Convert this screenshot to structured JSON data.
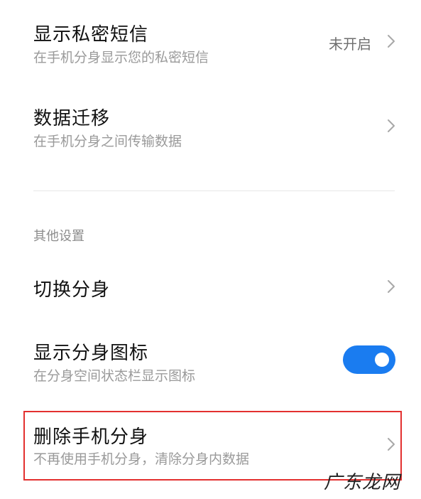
{
  "settings": {
    "private_sms": {
      "title": "显示私密短信",
      "subtitle": "在手机分身显示您的私密短信",
      "value": "未开启"
    },
    "data_migration": {
      "title": "数据迁移",
      "subtitle": "在手机分身之间传输数据"
    },
    "section_other": {
      "label": "其他设置"
    },
    "switch_profile": {
      "title": "切换分身"
    },
    "show_icon": {
      "title": "显示分身图标",
      "subtitle": "在分身空间状态栏显示图标",
      "enabled": true
    },
    "delete_profile": {
      "title": "删除手机分身",
      "subtitle": "不再使用手机分身，清除分身内数据"
    }
  },
  "watermark": "广东龙网",
  "colors": {
    "toggle_on": "#1a7cf0",
    "highlight_border": "#e3302f",
    "title_text": "#111111",
    "subtitle_text": "#9a9a9a"
  }
}
